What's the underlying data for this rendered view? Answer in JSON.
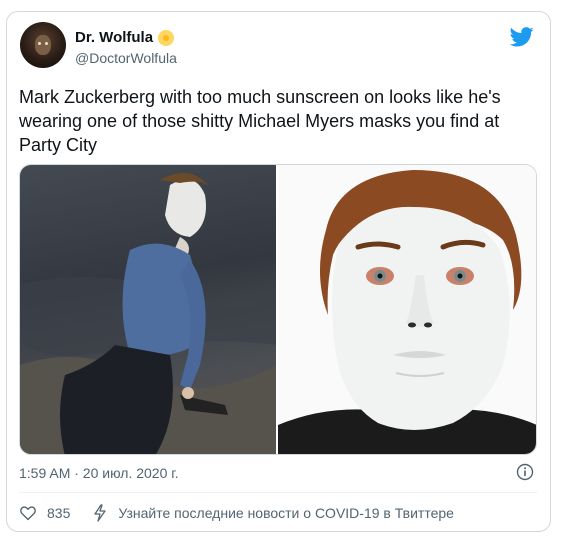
{
  "author": {
    "name": "Dr. Wolfula",
    "handle": "@DoctorWolfula"
  },
  "tweet": {
    "text": "Mark Zuckerberg with too much sunscreen on looks like he's wearing one of those shitty Michael Myers masks you find at Party City"
  },
  "meta": {
    "timestamp": "1:59 AM · 20 июл. 2020 г."
  },
  "actions": {
    "likes": "835",
    "covid_link": "Узнайте последние новости о COVID-19 в Твиттере"
  },
  "icons": {
    "brand": "twitter-bird-icon",
    "badge": "sun-badge-icon",
    "like": "heart-icon",
    "info": "info-icon",
    "bolt": "lightning-icon"
  },
  "colors": {
    "twitter_blue": "#1d9bf0",
    "text_primary": "#0f1419",
    "text_secondary": "#536471",
    "badge_yellow": "#ffd65e"
  }
}
